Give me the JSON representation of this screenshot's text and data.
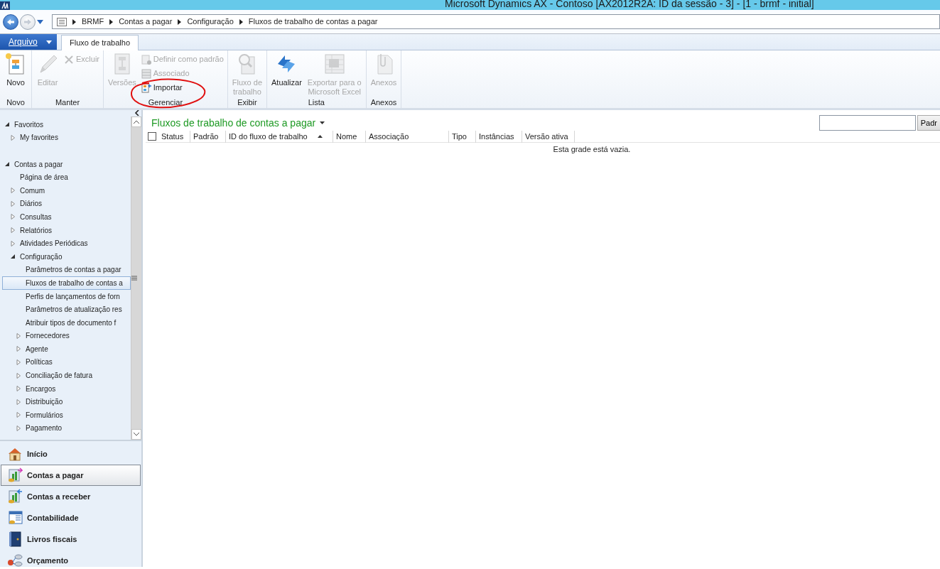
{
  "window": {
    "title": "Microsoft Dynamics AX - Contoso [AX2012R2A: ID da sessão - 3] -  [1 - brmf - initial]"
  },
  "breadcrumb": [
    "BRMF",
    "Contas a pagar",
    "Configuração",
    "Fluxos de trabalho de contas a pagar"
  ],
  "file_menu": "Arquivo",
  "tabs": [
    {
      "label": "Fluxo de trabalho",
      "selected": true
    }
  ],
  "ribbon": [
    {
      "label": "Novo",
      "buttons": [
        {
          "label": "Novo",
          "kind": "large",
          "disabled": false
        }
      ]
    },
    {
      "label": "Manter",
      "buttons": [
        {
          "label": "Editar",
          "kind": "large",
          "disabled": true
        },
        {
          "label": "Excluir",
          "kind": "small",
          "disabled": true
        }
      ]
    },
    {
      "label": "Gerenciar",
      "buttons": [
        {
          "label": "Versões",
          "kind": "large",
          "disabled": true
        },
        {
          "label": "Definir como padrão",
          "kind": "small",
          "disabled": true
        },
        {
          "label": "Associado",
          "kind": "small",
          "disabled": true
        },
        {
          "label": "Importar",
          "kind": "small",
          "disabled": false
        }
      ]
    },
    {
      "label": "Exibir",
      "buttons": [
        {
          "label": "Fluxo de\ntrabalho",
          "kind": "large",
          "disabled": true
        }
      ]
    },
    {
      "label": "Lista",
      "buttons": [
        {
          "label": "Atualizar",
          "kind": "large",
          "disabled": false
        },
        {
          "label": "Exportar para o\nMicrosoft Excel",
          "kind": "large",
          "disabled": true
        }
      ]
    },
    {
      "label": "Anexos",
      "buttons": [
        {
          "label": "Anexos",
          "kind": "large",
          "disabled": true
        }
      ]
    }
  ],
  "tree": [
    {
      "label": "Favoritos",
      "kind": "folder",
      "expanded": true,
      "selected": false,
      "children": [
        {
          "label": "My favorites",
          "kind": "folder",
          "expanded": false,
          "selected": false
        }
      ]
    },
    {
      "label": "Contas a pagar",
      "kind": "folder",
      "expanded": true,
      "selected": false,
      "children": [
        {
          "label": "Página de área",
          "kind": "leaf",
          "selected": false
        },
        {
          "label": "Comum",
          "kind": "folder",
          "expanded": false,
          "selected": false
        },
        {
          "label": "Diários",
          "kind": "folder",
          "expanded": false,
          "selected": false
        },
        {
          "label": "Consultas",
          "kind": "folder",
          "expanded": false,
          "selected": false
        },
        {
          "label": "Relatórios",
          "kind": "folder",
          "expanded": false,
          "selected": false
        },
        {
          "label": "Atividades Periódicas",
          "kind": "folder",
          "expanded": false,
          "selected": false
        },
        {
          "label": "Configuração",
          "kind": "folder",
          "expanded": true,
          "selected": false,
          "children": [
            {
              "label": "Parâmetros de contas a pagar",
              "kind": "leaf",
              "selected": false
            },
            {
              "label": "Fluxos de trabalho de contas a",
              "kind": "leaf",
              "selected": true
            },
            {
              "label": "Perfis de lançamentos de forn",
              "kind": "leaf",
              "selected": false
            },
            {
              "label": "Parâmetros de atualização res",
              "kind": "leaf",
              "selected": false
            },
            {
              "label": "Atribuir tipos de documento f",
              "kind": "leaf",
              "selected": false
            },
            {
              "label": "Fornecedores",
              "kind": "folder",
              "expanded": false,
              "selected": false
            },
            {
              "label": "Agente",
              "kind": "folder",
              "expanded": false,
              "selected": false
            },
            {
              "label": "Políticas",
              "kind": "folder",
              "expanded": false,
              "selected": false
            },
            {
              "label": "Conciliação de fatura",
              "kind": "folder",
              "expanded": false,
              "selected": false
            },
            {
              "label": "Encargos",
              "kind": "folder",
              "expanded": false,
              "selected": false
            },
            {
              "label": "Distribuição",
              "kind": "folder",
              "expanded": false,
              "selected": false
            },
            {
              "label": "Formulários",
              "kind": "folder",
              "expanded": false,
              "selected": false
            },
            {
              "label": "Pagamento",
              "kind": "folder",
              "expanded": false,
              "selected": false
            }
          ]
        }
      ]
    }
  ],
  "modules": [
    {
      "label": "Início",
      "selected": false
    },
    {
      "label": "Contas a pagar",
      "selected": true
    },
    {
      "label": "Contas a receber",
      "selected": false
    },
    {
      "label": "Contabilidade",
      "selected": false
    },
    {
      "label": "Livros fiscais",
      "selected": false
    },
    {
      "label": "Orçamento",
      "selected": false
    }
  ],
  "grid": {
    "title": "Fluxos de trabalho de contas a pagar",
    "search_button": "Padr",
    "select_all": {
      "checked": false
    },
    "columns": [
      {
        "label": "Status",
        "sorted": false
      },
      {
        "label": "Padrão",
        "sorted": false
      },
      {
        "label": "ID do fluxo de trabalho",
        "sorted": true
      },
      {
        "label": "Nome",
        "sorted": false
      },
      {
        "label": "Associação",
        "sorted": false
      },
      {
        "label": "Tipo",
        "sorted": false
      },
      {
        "label": "Instâncias",
        "sorted": false
      },
      {
        "label": "Versão ativa",
        "sorted": false
      }
    ],
    "empty_message": "Esta grade está vazia."
  }
}
